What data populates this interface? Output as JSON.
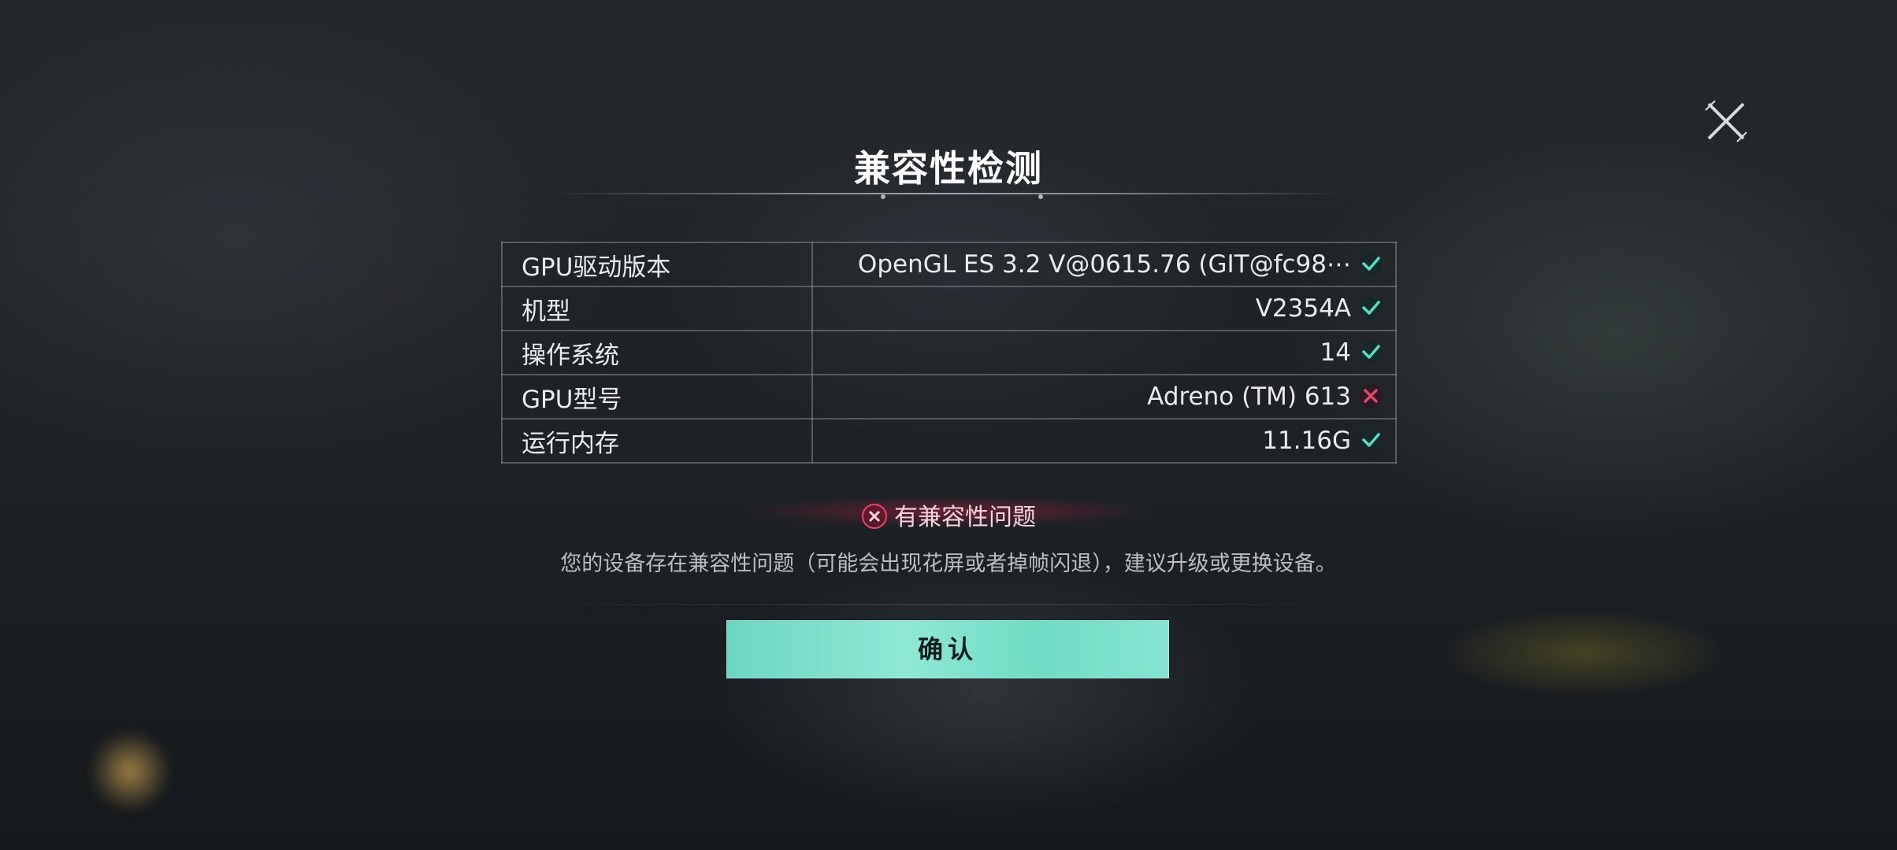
{
  "dialog": {
    "title": "兼容性检测",
    "rows": [
      {
        "label": "GPU驱动版本",
        "value": "OpenGL ES 3.2 V@0615.76 (GIT@fc98⋯",
        "status": "pass"
      },
      {
        "label": "机型",
        "value": "V2354A",
        "status": "pass"
      },
      {
        "label": "操作系统",
        "value": "14",
        "status": "pass"
      },
      {
        "label": "GPU型号",
        "value": "Adreno (TM) 613",
        "status": "fail"
      },
      {
        "label": "运行内存",
        "value": "11.16G",
        "status": "pass"
      }
    ],
    "warning": "有兼容性问题",
    "description": "您的设备存在兼容性问题（可能会出现花屏或者掉帧闪退），建议升级或更换设备。",
    "confirm_label": "确认"
  },
  "icons": {
    "close": "close-x-icon",
    "pass": "check-icon",
    "fail": "cross-icon",
    "warning": "cross-circle-icon"
  },
  "colors": {
    "accent": "#6fdcc4",
    "pass": "#4fe0c4",
    "fail": "#e2456e"
  }
}
